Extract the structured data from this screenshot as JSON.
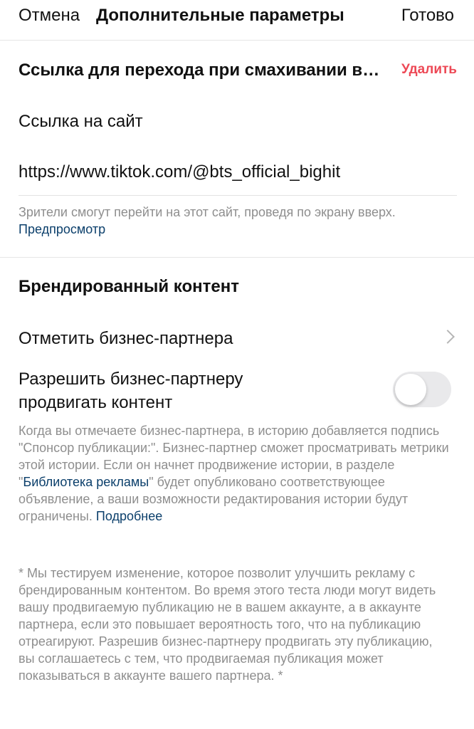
{
  "header": {
    "cancel": "Отмена",
    "title": "Дополнительные параметры",
    "done": "Готово"
  },
  "swipe_link": {
    "title": "Ссылка для перехода при смахивании вверх",
    "delete": "Удалить",
    "field_label": "Ссылка на сайт",
    "url": "https://www.tiktok.com/@bts_official_bighit",
    "help": "Зрители смогут перейти на этот сайт, проведя по экрану вверх.",
    "preview_link": "Предпросмотр"
  },
  "branded_content": {
    "title": "Брендированный контент",
    "tag_partner": "Отметить бизнес-партнера",
    "allow_promote": "Разрешить бизнес-партнеру продвигать контент",
    "allow_promote_enabled": false,
    "help_part1": "Когда вы отмечаете бизнес-партнера, в историю добавляется подпись \"Спонсор публикации:\". Бизнес-партнер сможет просматривать метрики этой истории. Если он начнет продвижение истории, в разделе \"",
    "ad_library_link": "Библиотека рекламы",
    "help_part2": "\" будет опубликовано соответствующее объявление, а ваши возможности редактирования истории будут ограничены.",
    "more_link": "Подробнее",
    "test_note": "* Мы тестируем изменение, которое позволит улучшить рекламу с брендированным контентом. Во время этого теста люди могут видеть вашу продвигаемую публикацию не в вашем аккаунте, а в аккаунте партнера, если это повышает вероятность того, что на публикацию отреагируют. Разрешив бизнес-партнеру продвигать эту публикацию, вы соглашаетесь с тем, что продвигаемая публикация может показываться в аккаунте вашего партнера. *"
  },
  "colors": {
    "delete": "#ed4956",
    "link": "#0b3f6b",
    "secondary_text": "#8e8e8e",
    "toggle_off": "#e9e9eb"
  },
  "icons": {
    "chevron": "chevron-right-icon"
  }
}
